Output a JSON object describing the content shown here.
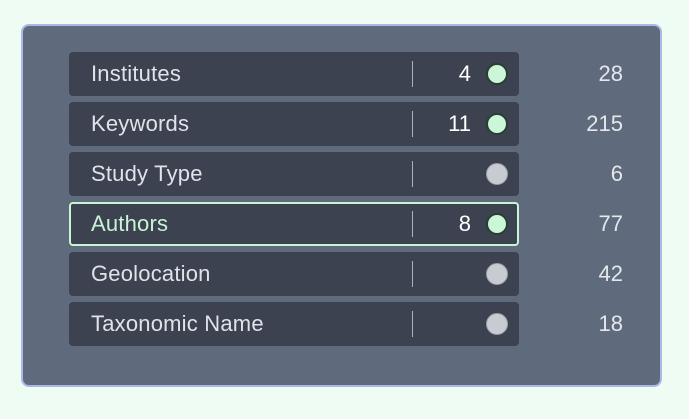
{
  "filters": [
    {
      "label": "Institutes",
      "selected": "4",
      "active": true,
      "highlighted": false,
      "total": "28"
    },
    {
      "label": "Keywords",
      "selected": "11",
      "active": true,
      "highlighted": false,
      "total": "215"
    },
    {
      "label": "Study Type",
      "selected": "",
      "active": false,
      "highlighted": false,
      "total": "6"
    },
    {
      "label": "Authors",
      "selected": "8",
      "active": true,
      "highlighted": true,
      "total": "77"
    },
    {
      "label": "Geolocation",
      "selected": "",
      "active": false,
      "highlighted": false,
      "total": "42"
    },
    {
      "label": "Taxonomic Name",
      "selected": "",
      "active": false,
      "highlighted": false,
      "total": "18"
    }
  ],
  "colors": {
    "background": "#eefcf4",
    "panel": "#5f6b7d",
    "pill": "#3c4250",
    "active_dot": "#cbf6d8",
    "inactive_dot": "#c8ccd2",
    "highlight_border": "#c9f3d6"
  }
}
